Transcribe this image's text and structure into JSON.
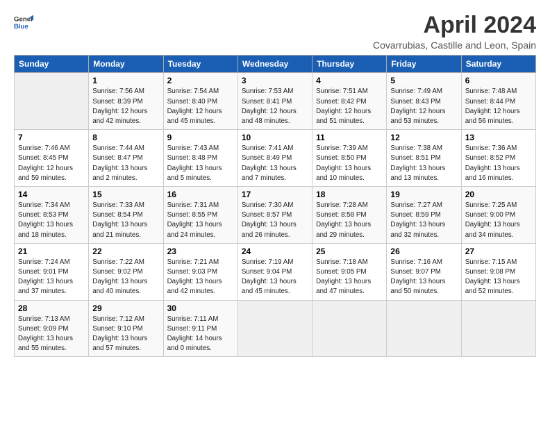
{
  "header": {
    "logo_general": "General",
    "logo_blue": "Blue",
    "title": "April 2024",
    "subtitle": "Covarrubias, Castille and Leon, Spain"
  },
  "columns": [
    "Sunday",
    "Monday",
    "Tuesday",
    "Wednesday",
    "Thursday",
    "Friday",
    "Saturday"
  ],
  "weeks": [
    [
      {
        "num": "",
        "info": ""
      },
      {
        "num": "1",
        "info": "Sunrise: 7:56 AM\nSunset: 8:39 PM\nDaylight: 12 hours\nand 42 minutes."
      },
      {
        "num": "2",
        "info": "Sunrise: 7:54 AM\nSunset: 8:40 PM\nDaylight: 12 hours\nand 45 minutes."
      },
      {
        "num": "3",
        "info": "Sunrise: 7:53 AM\nSunset: 8:41 PM\nDaylight: 12 hours\nand 48 minutes."
      },
      {
        "num": "4",
        "info": "Sunrise: 7:51 AM\nSunset: 8:42 PM\nDaylight: 12 hours\nand 51 minutes."
      },
      {
        "num": "5",
        "info": "Sunrise: 7:49 AM\nSunset: 8:43 PM\nDaylight: 12 hours\nand 53 minutes."
      },
      {
        "num": "6",
        "info": "Sunrise: 7:48 AM\nSunset: 8:44 PM\nDaylight: 12 hours\nand 56 minutes."
      }
    ],
    [
      {
        "num": "7",
        "info": "Sunrise: 7:46 AM\nSunset: 8:45 PM\nDaylight: 12 hours\nand 59 minutes."
      },
      {
        "num": "8",
        "info": "Sunrise: 7:44 AM\nSunset: 8:47 PM\nDaylight: 13 hours\nand 2 minutes."
      },
      {
        "num": "9",
        "info": "Sunrise: 7:43 AM\nSunset: 8:48 PM\nDaylight: 13 hours\nand 5 minutes."
      },
      {
        "num": "10",
        "info": "Sunrise: 7:41 AM\nSunset: 8:49 PM\nDaylight: 13 hours\nand 7 minutes."
      },
      {
        "num": "11",
        "info": "Sunrise: 7:39 AM\nSunset: 8:50 PM\nDaylight: 13 hours\nand 10 minutes."
      },
      {
        "num": "12",
        "info": "Sunrise: 7:38 AM\nSunset: 8:51 PM\nDaylight: 13 hours\nand 13 minutes."
      },
      {
        "num": "13",
        "info": "Sunrise: 7:36 AM\nSunset: 8:52 PM\nDaylight: 13 hours\nand 16 minutes."
      }
    ],
    [
      {
        "num": "14",
        "info": "Sunrise: 7:34 AM\nSunset: 8:53 PM\nDaylight: 13 hours\nand 18 minutes."
      },
      {
        "num": "15",
        "info": "Sunrise: 7:33 AM\nSunset: 8:54 PM\nDaylight: 13 hours\nand 21 minutes."
      },
      {
        "num": "16",
        "info": "Sunrise: 7:31 AM\nSunset: 8:55 PM\nDaylight: 13 hours\nand 24 minutes."
      },
      {
        "num": "17",
        "info": "Sunrise: 7:30 AM\nSunset: 8:57 PM\nDaylight: 13 hours\nand 26 minutes."
      },
      {
        "num": "18",
        "info": "Sunrise: 7:28 AM\nSunset: 8:58 PM\nDaylight: 13 hours\nand 29 minutes."
      },
      {
        "num": "19",
        "info": "Sunrise: 7:27 AM\nSunset: 8:59 PM\nDaylight: 13 hours\nand 32 minutes."
      },
      {
        "num": "20",
        "info": "Sunrise: 7:25 AM\nSunset: 9:00 PM\nDaylight: 13 hours\nand 34 minutes."
      }
    ],
    [
      {
        "num": "21",
        "info": "Sunrise: 7:24 AM\nSunset: 9:01 PM\nDaylight: 13 hours\nand 37 minutes."
      },
      {
        "num": "22",
        "info": "Sunrise: 7:22 AM\nSunset: 9:02 PM\nDaylight: 13 hours\nand 40 minutes."
      },
      {
        "num": "23",
        "info": "Sunrise: 7:21 AM\nSunset: 9:03 PM\nDaylight: 13 hours\nand 42 minutes."
      },
      {
        "num": "24",
        "info": "Sunrise: 7:19 AM\nSunset: 9:04 PM\nDaylight: 13 hours\nand 45 minutes."
      },
      {
        "num": "25",
        "info": "Sunrise: 7:18 AM\nSunset: 9:05 PM\nDaylight: 13 hours\nand 47 minutes."
      },
      {
        "num": "26",
        "info": "Sunrise: 7:16 AM\nSunset: 9:07 PM\nDaylight: 13 hours\nand 50 minutes."
      },
      {
        "num": "27",
        "info": "Sunrise: 7:15 AM\nSunset: 9:08 PM\nDaylight: 13 hours\nand 52 minutes."
      }
    ],
    [
      {
        "num": "28",
        "info": "Sunrise: 7:13 AM\nSunset: 9:09 PM\nDaylight: 13 hours\nand 55 minutes."
      },
      {
        "num": "29",
        "info": "Sunrise: 7:12 AM\nSunset: 9:10 PM\nDaylight: 13 hours\nand 57 minutes."
      },
      {
        "num": "30",
        "info": "Sunrise: 7:11 AM\nSunset: 9:11 PM\nDaylight: 14 hours\nand 0 minutes."
      },
      {
        "num": "",
        "info": ""
      },
      {
        "num": "",
        "info": ""
      },
      {
        "num": "",
        "info": ""
      },
      {
        "num": "",
        "info": ""
      }
    ]
  ]
}
